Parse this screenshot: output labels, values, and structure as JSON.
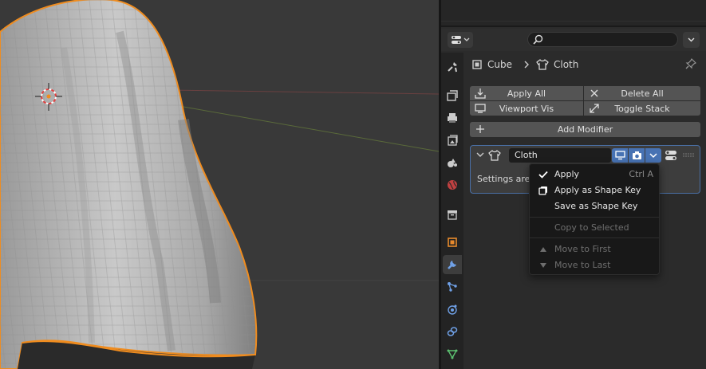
{
  "properties": {
    "search": {
      "placeholder": ""
    },
    "breadcrumb": {
      "object": "Cube",
      "modifier": "Cloth"
    }
  },
  "toolbar": {
    "apply_all": "Apply All",
    "delete_all": "Delete All",
    "viewport_vis": "Viewport Vis",
    "toggle_stack": "Toggle Stack",
    "add_modifier": "Add Modifier"
  },
  "modifier": {
    "name": "Cloth",
    "settings_text": "Settings are"
  },
  "menu": {
    "apply": {
      "label": "Apply",
      "shortcut": "Ctrl A"
    },
    "apply_shape_key": "Apply as Shape Key",
    "save_shape_key": "Save as Shape Key",
    "copy_selected": "Copy to Selected",
    "move_first": "Move to First",
    "move_last": "Move to Last"
  },
  "tabs": [
    "tool-icon",
    "render-icon",
    "output-icon",
    "view-layer-icon",
    "scene-icon",
    "world-icon",
    "collection-icon",
    "object-icon",
    "modifier-icon",
    "particles-icon",
    "physics-icon",
    "constraints-icon",
    "data-icon"
  ],
  "colors": {
    "accent": "#4772b3",
    "selection_outline": "#f08c1e",
    "mesh": "#c8c8c8"
  }
}
